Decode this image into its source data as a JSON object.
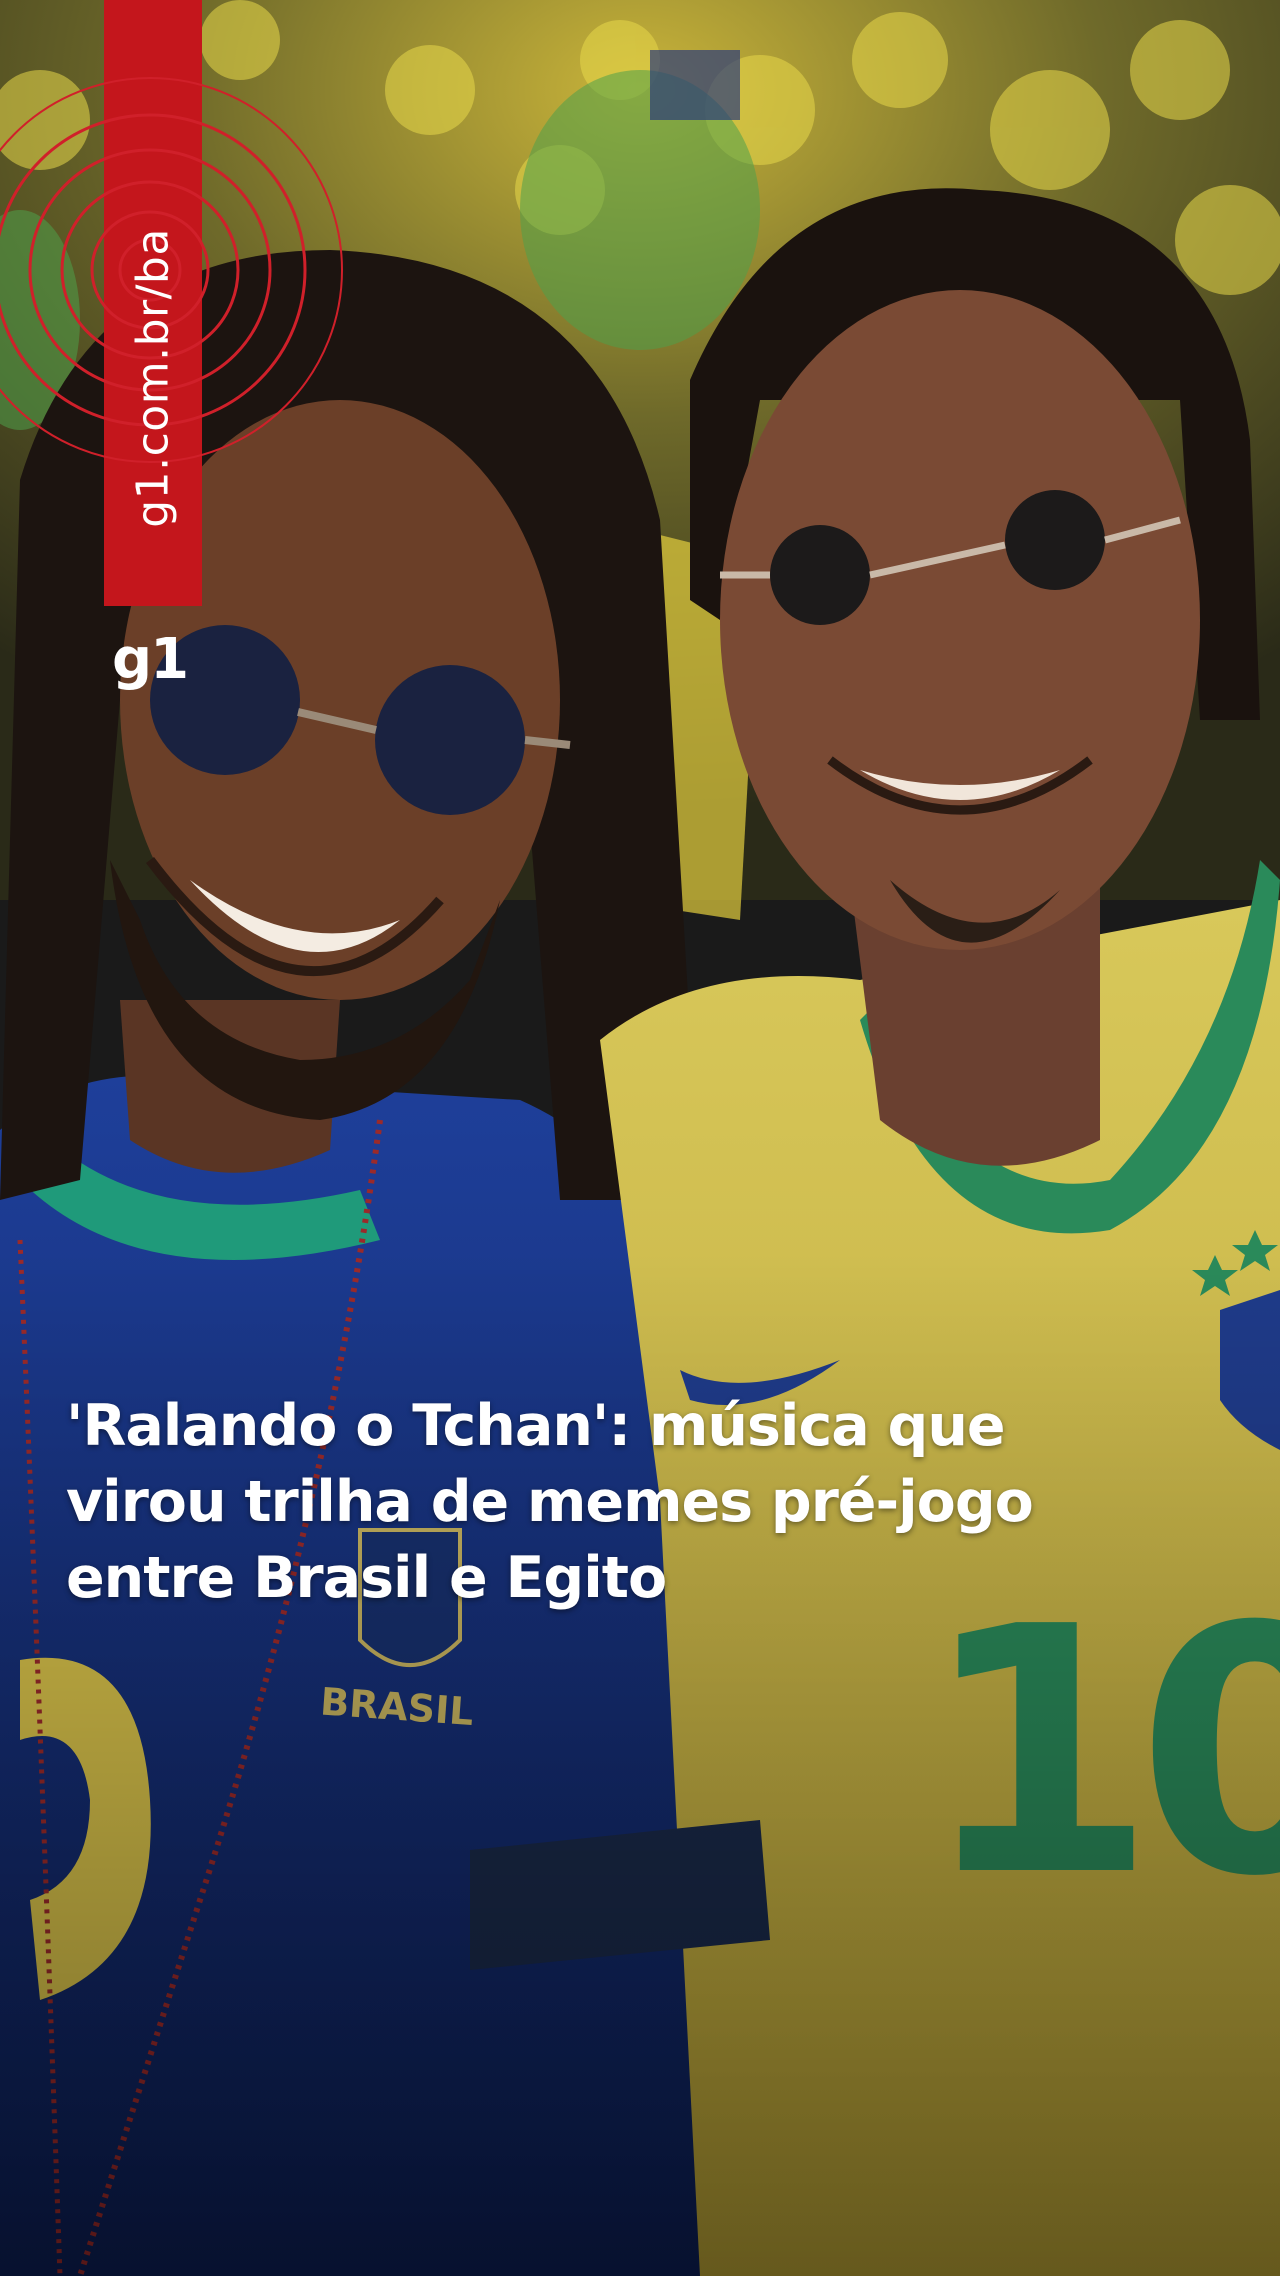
{
  "brand": {
    "url": "g1.com.br/ba",
    "logo": "g1",
    "accent_color": "#c4161c"
  },
  "headline": {
    "lines": [
      "'Ralando o Tchan': música que",
      "virou trilha de memes pré-jogo",
      "entre Brasil e Egito"
    ]
  },
  "jersey_texts": {
    "left_chest": "BRASIL",
    "right_number": "10"
  },
  "icons": [
    "radio-waves-icon",
    "g1-logo"
  ]
}
